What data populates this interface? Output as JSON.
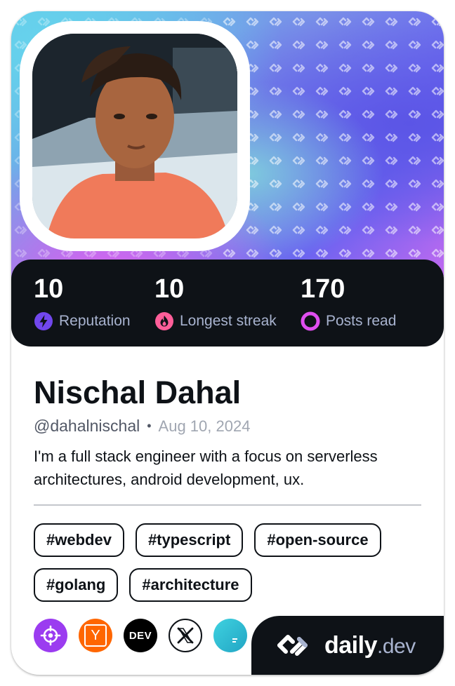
{
  "profile": {
    "name": "Nischal Dahal",
    "handle": "@dahalnischal",
    "separator": "•",
    "joined": "Aug 10, 2024",
    "bio": "I'm a full stack engineer with a focus on serverless architectures, android development, ux."
  },
  "stats": {
    "reputation": {
      "value": "10",
      "label": "Reputation"
    },
    "streak": {
      "value": "10",
      "label": "Longest streak"
    },
    "posts": {
      "value": "170",
      "label": "Posts read"
    }
  },
  "tags": [
    "#webdev",
    "#typescript",
    "#open-source",
    "#golang",
    "#architecture"
  ],
  "socials": {
    "hackernews_letter": "Y",
    "devto_text": "DEV"
  },
  "brand": {
    "name": "daily",
    "suffix": ".dev"
  },
  "colors": {
    "card_dark": "#0e1217",
    "reputation_purple": "#7147ed",
    "streak_pink": "#ff5e99",
    "posts_magenta": "#e04ef0",
    "hackernews_orange": "#ff6600"
  },
  "icons": {
    "reputation": "bolt-icon",
    "streak": "flame-icon",
    "posts": "ring-icon",
    "brand": "daily-dev-logo-icon"
  }
}
